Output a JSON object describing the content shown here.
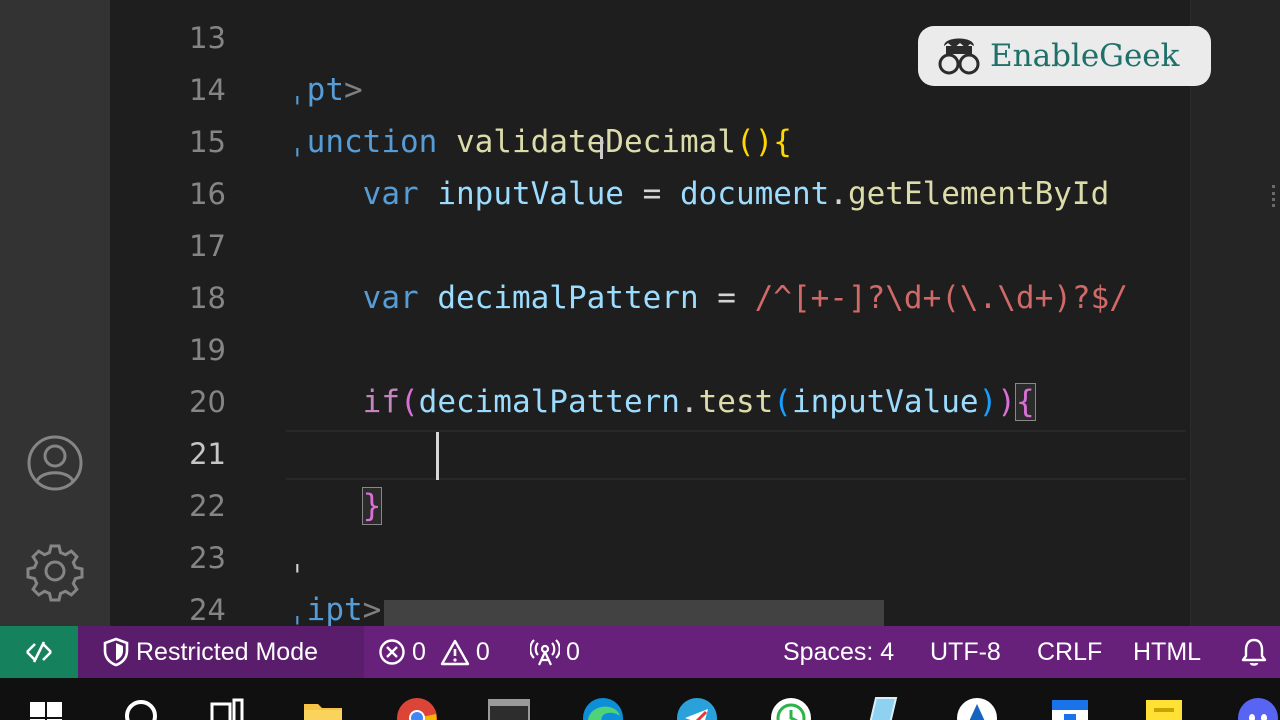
{
  "editor": {
    "lines": [
      {
        "number": "13",
        "tokens": []
      },
      {
        "number": "14",
        "tokens": [
          {
            "t": "ˌpt",
            "c": "tok-tag"
          },
          {
            "t": ">",
            "c": "tok-punct"
          }
        ]
      },
      {
        "number": "15",
        "tokens": [
          {
            "t": "ˌunction",
            "c": "tok-kw"
          },
          {
            "t": " ",
            "c": "tok-op"
          },
          {
            "t": "validateDecimal",
            "c": "tok-fn"
          },
          {
            "t": "()",
            "c": "tok-b1"
          },
          {
            "t": "{",
            "c": "tok-b1"
          }
        ]
      },
      {
        "number": "16",
        "tokens": [
          {
            "t": "    ",
            "c": "tok-op"
          },
          {
            "t": "var",
            "c": "tok-kw"
          },
          {
            "t": " ",
            "c": "tok-op"
          },
          {
            "t": "inputValue",
            "c": "tok-var"
          },
          {
            "t": " = ",
            "c": "tok-op"
          },
          {
            "t": "document",
            "c": "tok-var"
          },
          {
            "t": ".",
            "c": "tok-op"
          },
          {
            "t": "getElementById",
            "c": "tok-fn"
          }
        ]
      },
      {
        "number": "17",
        "tokens": []
      },
      {
        "number": "18",
        "tokens": [
          {
            "t": "    ",
            "c": "tok-op"
          },
          {
            "t": "var",
            "c": "tok-kw"
          },
          {
            "t": " ",
            "c": "tok-op"
          },
          {
            "t": "decimalPattern",
            "c": "tok-var"
          },
          {
            "t": " = ",
            "c": "tok-op"
          },
          {
            "t": "/^[+-]?\\d+(\\.\\d+)?$/",
            "c": "tok-regex"
          }
        ]
      },
      {
        "number": "19",
        "tokens": []
      },
      {
        "number": "20",
        "tokens": [
          {
            "t": "    ",
            "c": "tok-op"
          },
          {
            "t": "if",
            "c": "tok-ctrl"
          },
          {
            "t": "(",
            "c": "tok-b2"
          },
          {
            "t": "decimalPattern",
            "c": "tok-var"
          },
          {
            "t": ".",
            "c": "tok-op"
          },
          {
            "t": "test",
            "c": "tok-fn"
          },
          {
            "t": "(",
            "c": "tok-b3"
          },
          {
            "t": "inputValue",
            "c": "tok-var"
          },
          {
            "t": ")",
            "c": "tok-b3"
          },
          {
            "t": ")",
            "c": "tok-b2"
          },
          {
            "t": "{",
            "c": "tok-b2 brk-match"
          }
        ]
      },
      {
        "number": "21",
        "tokens": [],
        "active": true
      },
      {
        "number": "22",
        "tokens": [
          {
            "t": "    ",
            "c": "tok-op"
          },
          {
            "t": "}",
            "c": "tok-b2 brk-match"
          }
        ]
      },
      {
        "number": "23",
        "tokens": [
          {
            "t": "ˌ",
            "c": "tok-op"
          }
        ]
      },
      {
        "number": "24",
        "tokens": [
          {
            "t": "ˌipt",
            "c": "tok-tag"
          },
          {
            "t": ">",
            "c": "tok-punct"
          }
        ]
      }
    ]
  },
  "logo": {
    "text": "EnableGeek"
  },
  "status_bar": {
    "restricted_mode": "Restricted Mode",
    "errors": "0",
    "warnings": "0",
    "ports": "0",
    "spaces": "Spaces: 4",
    "encoding": "UTF-8",
    "eol": "CRLF",
    "language": "HTML"
  },
  "colors": {
    "status_bar": "#68217a",
    "remote_indicator": "#16825d",
    "editor_bg": "#1e1e1e",
    "activity_bar": "#333333"
  },
  "icons": {
    "activity_bar": [
      "account-icon",
      "settings-gear-icon"
    ],
    "status_bar": [
      "remote-icon",
      "shield-icon",
      "error-icon",
      "warning-icon",
      "broadcast-icon",
      "bell-icon"
    ],
    "taskbar": [
      "windows-start-icon",
      "search-icon",
      "task-view-icon",
      "file-explorer-icon",
      "chrome-icon",
      "terminal-icon",
      "edge-icon",
      "telegram-icon",
      "clock-app-icon",
      "notepad-icon",
      "app-icon",
      "calendar-icon",
      "sticky-notes-icon",
      "discord-icon"
    ]
  }
}
